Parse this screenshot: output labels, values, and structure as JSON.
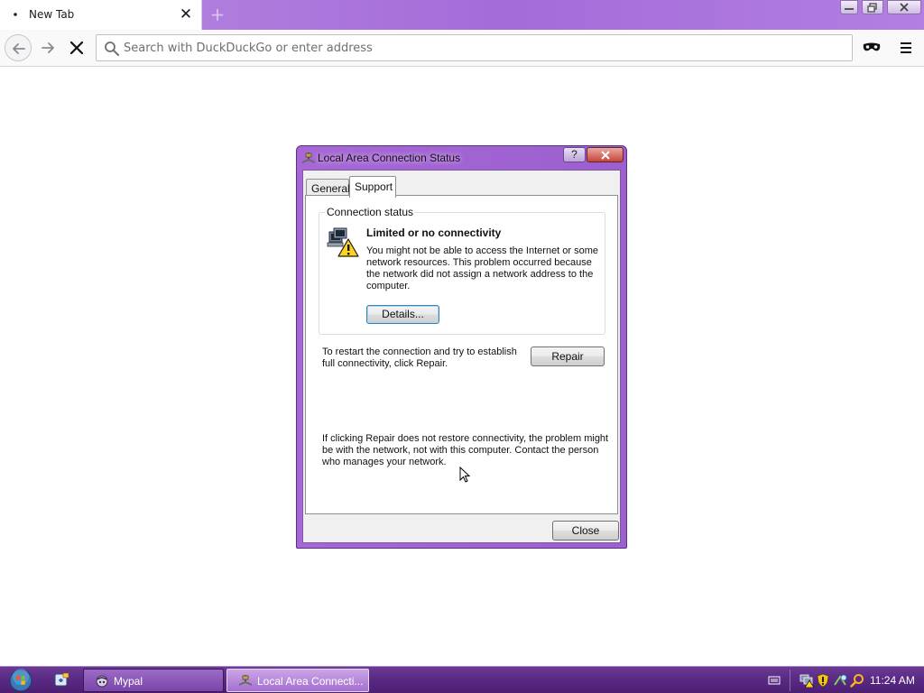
{
  "browser": {
    "tab_title": "New Tab",
    "tab_close": "✕",
    "new_tab": "+",
    "search_placeholder": "Search with DuckDuckGo or enter address"
  },
  "dialog": {
    "title": "Local Area Connection Status",
    "help_label": "?",
    "tabs": [
      {
        "label": "General",
        "active": false
      },
      {
        "label": "Support",
        "active": true
      }
    ],
    "connection_status": {
      "legend": "Connection status",
      "heading": "Limited or no connectivity",
      "description": "You might not be able to access the Internet or some network resources. This problem occurred because the network did not assign a network address to the computer.",
      "details_button": "Details..."
    },
    "repair_text": "To restart the connection and try to establish full connectivity, click Repair.",
    "repair_button": "Repair",
    "help_text": "If clicking Repair does not restore connectivity, the problem might be with the network, not with this computer. Contact the person who manages your network.",
    "close_button": "Close"
  },
  "taskbar": {
    "buttons": [
      {
        "label": "Mypal",
        "icon": "mypal-icon",
        "active": false
      },
      {
        "label": "Local Area Connecti...",
        "icon": "network-icon",
        "active": true
      }
    ],
    "clock": "11:24 AM"
  },
  "icons": [
    "back-arrow-icon",
    "forward-arrow-icon",
    "stop-icon",
    "search-icon",
    "private-mask-icon",
    "hamburger-menu-icon",
    "warning-icon",
    "network-icon",
    "windows-orb-icon",
    "shield-icon",
    "search-tray-icon"
  ],
  "colors": {
    "chrome_accent": "#a46bd9",
    "taskbar": "#5a2a85",
    "dialog_frame": "#a768d6",
    "close_button_red": "#c6453b"
  }
}
